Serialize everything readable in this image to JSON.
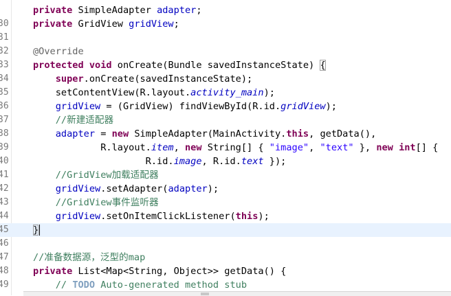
{
  "editor": {
    "lines": [
      {
        "num": "",
        "segments": [
          {
            "t": "private",
            "c": "kw"
          },
          {
            "t": " SimpleAdapter ",
            "c": ""
          },
          {
            "t": "adapter",
            "c": "fld"
          },
          {
            "t": ";",
            "c": ""
          }
        ]
      },
      {
        "num": "30",
        "segments": [
          {
            "t": "private",
            "c": "kw"
          },
          {
            "t": " GridView ",
            "c": ""
          },
          {
            "t": "gridView",
            "c": "fld"
          },
          {
            "t": ";",
            "c": ""
          }
        ]
      },
      {
        "num": "31",
        "segments": []
      },
      {
        "num": "32",
        "segments": [
          {
            "t": "@Override",
            "c": "ann"
          }
        ]
      },
      {
        "num": "33",
        "segments": [
          {
            "t": "protected",
            "c": "kw"
          },
          {
            "t": " ",
            "c": ""
          },
          {
            "t": "void",
            "c": "kw"
          },
          {
            "t": " onCreate(Bundle savedInstanceState) ",
            "c": ""
          },
          {
            "t": "{",
            "c": "brace"
          }
        ]
      },
      {
        "num": "34",
        "segments": [
          {
            "t": "    ",
            "c": ""
          },
          {
            "t": "super",
            "c": "kw"
          },
          {
            "t": ".onCreate(savedInstanceState);",
            "c": ""
          }
        ]
      },
      {
        "num": "35",
        "segments": [
          {
            "t": "    setContentView(R.layout.",
            "c": ""
          },
          {
            "t": "activity_main",
            "c": "sfld"
          },
          {
            "t": ");",
            "c": ""
          }
        ]
      },
      {
        "num": "36",
        "segments": [
          {
            "t": "    ",
            "c": ""
          },
          {
            "t": "gridView",
            "c": "fld"
          },
          {
            "t": " = (GridView) findViewById(R.id.",
            "c": ""
          },
          {
            "t": "gridView",
            "c": "sfld"
          },
          {
            "t": ");",
            "c": ""
          }
        ]
      },
      {
        "num": "37",
        "segments": [
          {
            "t": "    ",
            "c": ""
          },
          {
            "t": "//新建适配器",
            "c": "cm"
          }
        ]
      },
      {
        "num": "38",
        "segments": [
          {
            "t": "    ",
            "c": ""
          },
          {
            "t": "adapter",
            "c": "fld"
          },
          {
            "t": " = ",
            "c": ""
          },
          {
            "t": "new",
            "c": "kw"
          },
          {
            "t": " SimpleAdapter(MainActivity.",
            "c": ""
          },
          {
            "t": "this",
            "c": "kw"
          },
          {
            "t": ", getData(),",
            "c": ""
          }
        ]
      },
      {
        "num": "39",
        "segments": [
          {
            "t": "            R.layout.",
            "c": ""
          },
          {
            "t": "item",
            "c": "sfld"
          },
          {
            "t": ", ",
            "c": ""
          },
          {
            "t": "new",
            "c": "kw"
          },
          {
            "t": " String[] { ",
            "c": ""
          },
          {
            "t": "\"image\"",
            "c": "str"
          },
          {
            "t": ", ",
            "c": ""
          },
          {
            "t": "\"text\"",
            "c": "str"
          },
          {
            "t": " }, ",
            "c": ""
          },
          {
            "t": "new",
            "c": "kw"
          },
          {
            "t": " ",
            "c": ""
          },
          {
            "t": "int",
            "c": "kw"
          },
          {
            "t": "[] {",
            "c": ""
          }
        ]
      },
      {
        "num": "40",
        "segments": [
          {
            "t": "                    R.id.",
            "c": ""
          },
          {
            "t": "image",
            "c": "sfld"
          },
          {
            "t": ", R.id.",
            "c": ""
          },
          {
            "t": "text",
            "c": "sfld"
          },
          {
            "t": " });",
            "c": ""
          }
        ]
      },
      {
        "num": "41",
        "segments": [
          {
            "t": "    ",
            "c": ""
          },
          {
            "t": "//GridView加载适配器",
            "c": "cm"
          }
        ]
      },
      {
        "num": "42",
        "segments": [
          {
            "t": "    ",
            "c": ""
          },
          {
            "t": "gridView",
            "c": "fld"
          },
          {
            "t": ".setAdapter(",
            "c": ""
          },
          {
            "t": "adapter",
            "c": "fld"
          },
          {
            "t": ");",
            "c": ""
          }
        ]
      },
      {
        "num": "43",
        "segments": [
          {
            "t": "    ",
            "c": ""
          },
          {
            "t": "//GridView事件监听器",
            "c": "cm"
          }
        ]
      },
      {
        "num": "44",
        "segments": [
          {
            "t": "    ",
            "c": ""
          },
          {
            "t": "gridView",
            "c": "fld"
          },
          {
            "t": ".setOnItemClickListener(",
            "c": ""
          },
          {
            "t": "this",
            "c": "kw"
          },
          {
            "t": ");",
            "c": ""
          }
        ]
      },
      {
        "num": "45",
        "current": true,
        "segments": [
          {
            "t": "}",
            "c": "brace"
          },
          {
            "t": "",
            "c": "caret"
          }
        ]
      },
      {
        "num": "46",
        "segments": []
      },
      {
        "num": "47",
        "segments": [
          {
            "t": "//准备数据源，泛型的map",
            "c": "cm"
          }
        ]
      },
      {
        "num": "48",
        "segments": [
          {
            "t": "private",
            "c": "kw"
          },
          {
            "t": " List<Map<String, Object>> getData() {",
            "c": ""
          }
        ]
      },
      {
        "num": "49",
        "segments": [
          {
            "t": "    ",
            "c": ""
          },
          {
            "t": "// ",
            "c": "cm"
          },
          {
            "t": "TODO",
            "c": "todo"
          },
          {
            "t": " Auto-generated method stub",
            "c": "cm"
          }
        ]
      }
    ]
  }
}
